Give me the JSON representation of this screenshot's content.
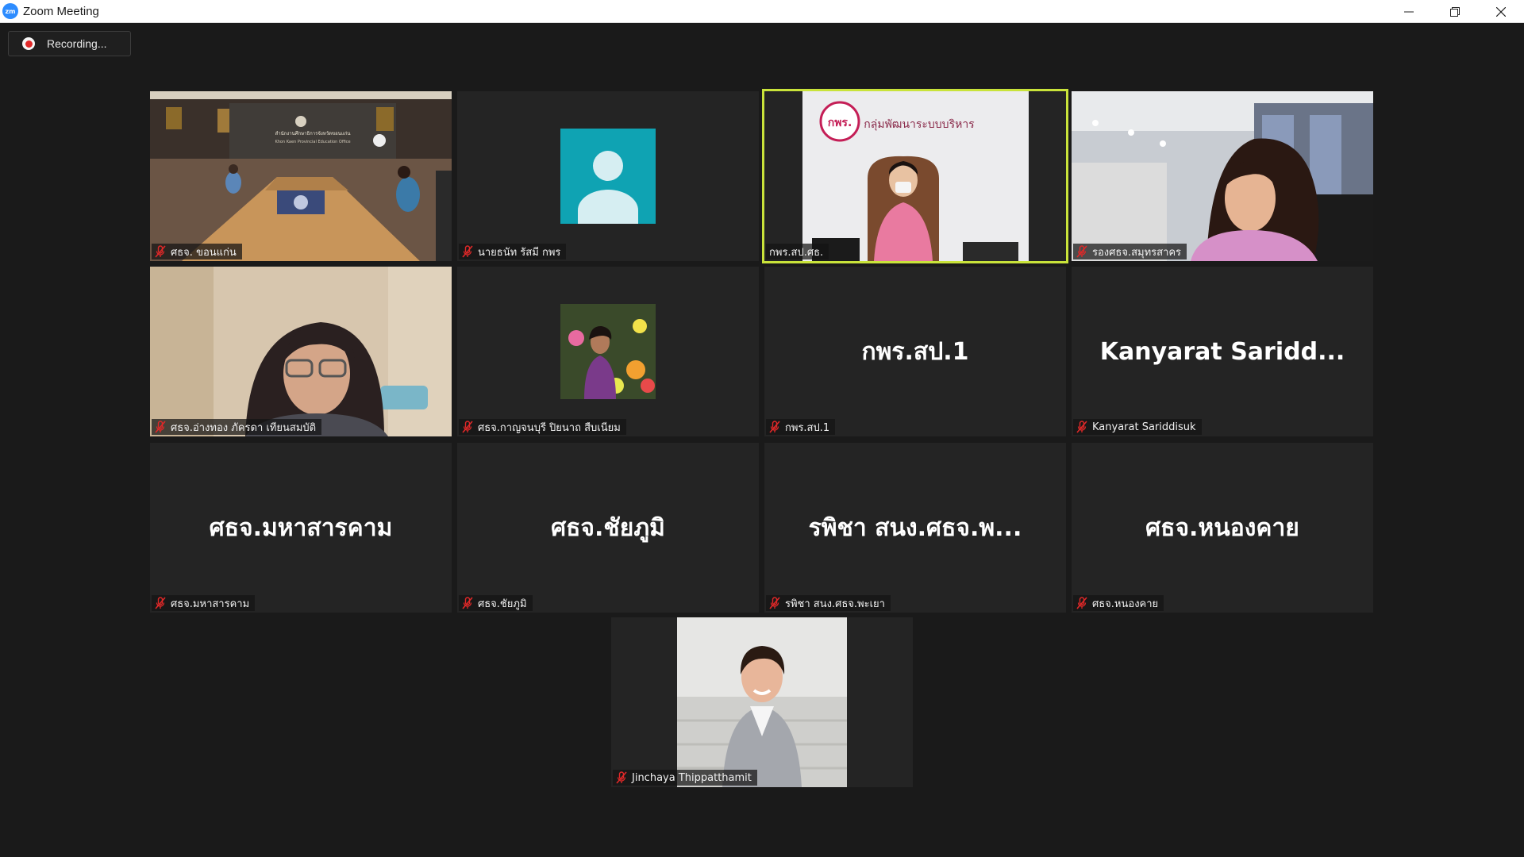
{
  "window": {
    "title": "Zoom Meeting"
  },
  "recording": {
    "label": "Recording..."
  },
  "colors": {
    "active_speaker": "#c9e33a",
    "mic_muted": "#e02828",
    "avatar_bg": "#0fa3b3"
  },
  "participants": [
    {
      "label": "ศธจ. ขอนแก่น",
      "big": ""
    },
    {
      "label": "นายธนัท รัสมี กพร",
      "big": ""
    },
    {
      "label": "กพร.สป.ศธ.",
      "big": ""
    },
    {
      "label": "รองศธจ.สมุทรสาคร",
      "big": ""
    },
    {
      "label": "ศธจ.อ่างทอง ภัครดา เทียนสมบัติ",
      "big": ""
    },
    {
      "label": "ศธจ.กาญจนบุรี ปิยนาถ สืบเนียม",
      "big": ""
    },
    {
      "label": "กพร.สป.1",
      "big": "กพร.สป.1"
    },
    {
      "label": "Kanyarat Sariddisuk",
      "big": "Kanyarat  Saridd..."
    },
    {
      "label": "ศธจ.มหาสารคาม",
      "big": "ศธจ.มหาสารคาม"
    },
    {
      "label": "ศธจ.ชัยภูมิ",
      "big": "ศธจ.ชัยภูมิ"
    },
    {
      "label": "รพิชา สนง.ศธจ.พะเยา",
      "big": "รพิชา สนง.ศธจ.พ..."
    },
    {
      "label": "ศธจ.หนองคาย",
      "big": "ศธจ.หนองคาย"
    },
    {
      "label": "Jinchaya Thippatthamit",
      "big": ""
    }
  ],
  "video": {
    "conference_room_sign_th": "สำนักงานศึกษาธิการจังหวัดขอนแก่น",
    "conference_room_sign_en": "Khon Kaen Provincial Education Office",
    "logo_text": "กพร.",
    "banner_text": "กลุ่มพัฒนาระบบบริหาร"
  }
}
